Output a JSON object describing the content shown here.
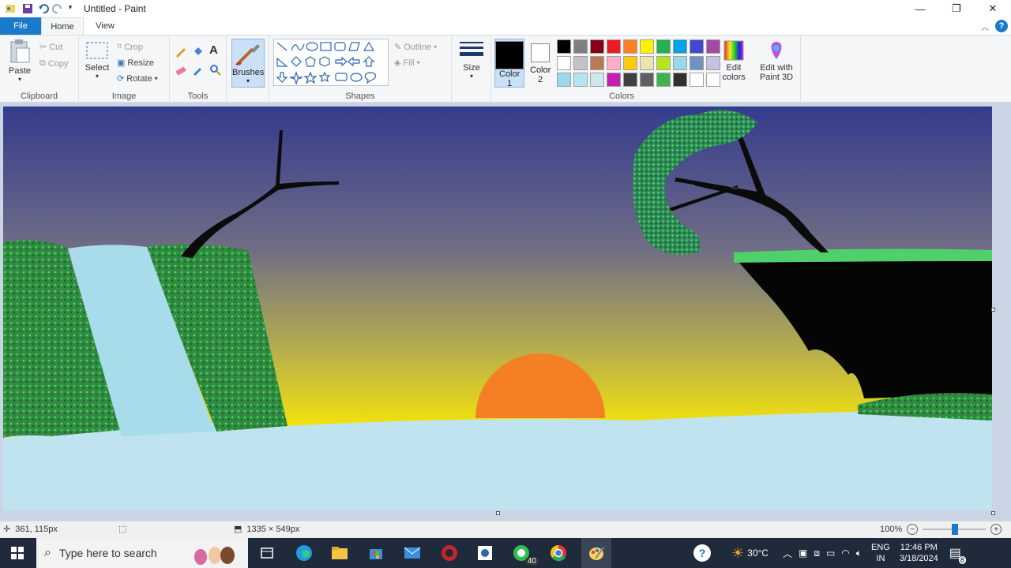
{
  "window": {
    "title": "Untitled - Paint"
  },
  "tabs": {
    "file": "File",
    "home": "Home",
    "view": "View"
  },
  "clipboard": {
    "paste": "Paste",
    "cut": "Cut",
    "copy": "Copy",
    "label": "Clipboard"
  },
  "image": {
    "select": "Select",
    "crop": "Crop",
    "resize": "Resize",
    "rotate": "Rotate",
    "label": "Image"
  },
  "tools": {
    "label": "Tools"
  },
  "brushes": {
    "label": "Brushes"
  },
  "shapes": {
    "outline": "Outline",
    "fill": "Fill",
    "label": "Shapes"
  },
  "size": {
    "label": "Size"
  },
  "colors": {
    "color1": "Color 1",
    "color2": "Color 2",
    "color1_value": "#000000",
    "color2_value": "#ffffff",
    "edit_colors": "Edit colors",
    "edit_paint3d": "Edit with Paint 3D",
    "label": "Colors",
    "palette": [
      "#000000",
      "#7f7f7f",
      "#880015",
      "#ed1c24",
      "#ff7f27",
      "#fff200",
      "#22b14c",
      "#00a2e8",
      "#3f48cc",
      "#a349a4",
      "#ffffff",
      "#c3c3c3",
      "#b97a57",
      "#ffaec9",
      "#ffc90e",
      "#efe4b0",
      "#b5e61d",
      "#99d9ea",
      "#7092be",
      "#c8bfe7",
      "#99d9ea",
      "#b3e5f2",
      "#cde7ee",
      "#c71fb1",
      "#404040",
      "#606060",
      "#3cb44b",
      "#303030",
      "#ffffff",
      "#ffffff"
    ]
  },
  "status": {
    "cursor": "361, 115px",
    "canvas_size": "1335 × 549px",
    "zoom": "100%"
  },
  "taskbar": {
    "search_placeholder": "Type here to search",
    "whatsapp_badge": "40",
    "temperature": "30°C",
    "language_top": "ENG",
    "language_bottom": "IN",
    "time": "12:46 PM",
    "date": "3/18/2024",
    "notifications": "8"
  }
}
